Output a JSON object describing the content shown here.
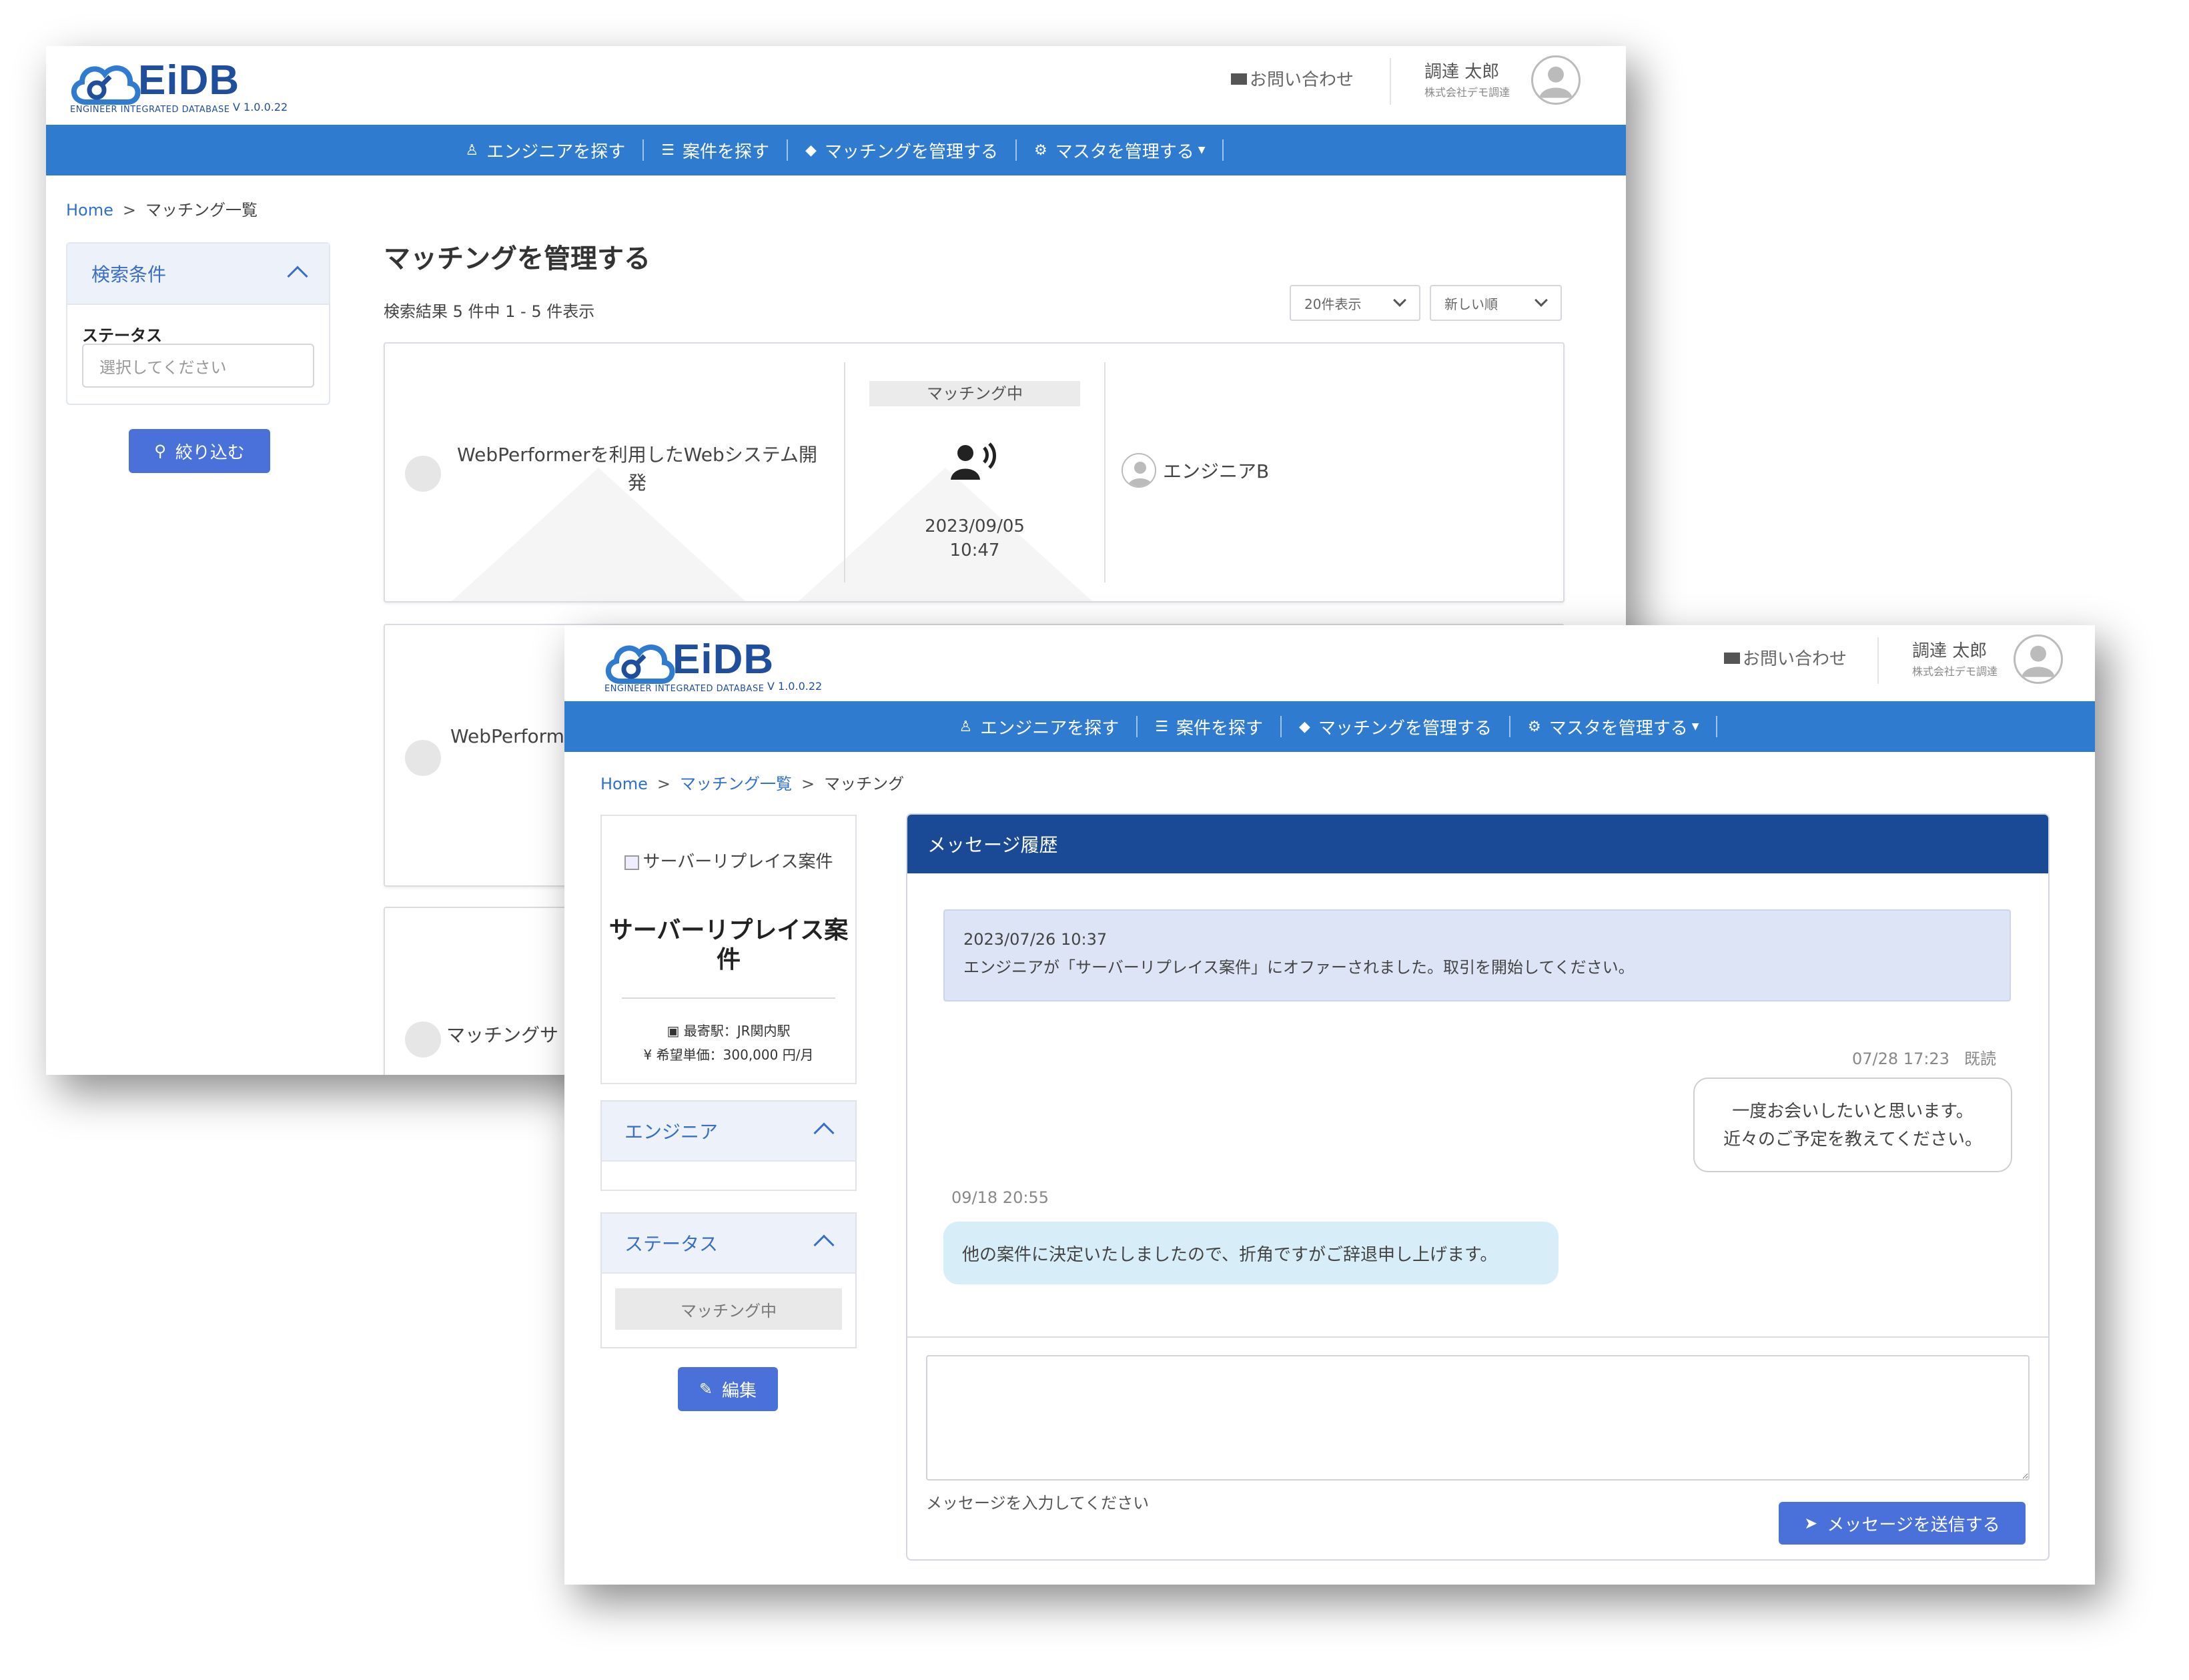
{
  "header": {
    "logo_text": "EiDB",
    "logo_sub": "ENGINEER INTEGRATED DATABASE",
    "version": "V 1.0.0.22",
    "contact_label": "お問い合わせ",
    "user_name": "調達 太郎",
    "user_company": "株式会社デモ調達"
  },
  "nav": {
    "items": [
      {
        "label": "エンジニアを探す",
        "icon": "user-search-icon"
      },
      {
        "label": "案件を探す",
        "icon": "list-search-icon"
      },
      {
        "label": "マッチングを管理する",
        "icon": "diamond-icon"
      },
      {
        "label": "マスタを管理する",
        "icon": "gear-icon",
        "has_caret": true
      }
    ]
  },
  "list_page": {
    "breadcrumb": {
      "home": "Home",
      "current": "マッチング一覧"
    },
    "search_panel": {
      "title": "検索条件",
      "status_label": "ステータス",
      "status_placeholder": "選択してください",
      "filter_button": "絞り込む"
    },
    "title": "マッチングを管理する",
    "result_count": "検索結果 5 件中 1 - 5 件表示",
    "per_page": "20件表示",
    "sort": "新しい順",
    "cards": [
      {
        "project": "WebPerformerを利用したWebシステム開発",
        "status": "マッチング中",
        "date": "2023/09/05",
        "time": "10:47",
        "engineer": "エンジニアB"
      },
      {
        "project": "WebPerform"
      },
      {
        "project": "マッチングサ"
      }
    ]
  },
  "detail_page": {
    "breadcrumb": {
      "home": "Home",
      "list": "マッチング一覧",
      "current": "マッチング"
    },
    "project_card": {
      "image_alt": "サーバーリプレイス案件",
      "name": "サーバーリプレイス案件",
      "station": "最寄駅：JR関内駅",
      "price": "希望単価：300,000 円/月"
    },
    "engineer_panel": {
      "title": "エンジニア"
    },
    "status_panel": {
      "title": "ステータス",
      "value": "マッチング中"
    },
    "edit_button": "編集",
    "messages": {
      "title": "メッセージ履歴",
      "system_time": "2023/07/26 10:37",
      "system_text": "エンジニアが「サーバーリプレイス案件」にオファーされました。取引を開始してください。",
      "sent_time": "07/28 17:23",
      "sent_read": "既読",
      "sent_text_line1": "一度お会いしたいと思います。",
      "sent_text_line2": "近々のご予定を教えてください。",
      "recv_time": "09/18 20:55",
      "recv_text": "他の案件に決定いたしましたので、折角ですがご辞退申し上げます。",
      "input_hint": "メッセージを入力してください",
      "send_button": "メッセージを送信する"
    }
  },
  "colors": {
    "nav_blue": "#2f7bd0",
    "brand_dark": "#1f4e9c",
    "button_blue": "#4a70d9",
    "message_header": "#1a4a96"
  }
}
